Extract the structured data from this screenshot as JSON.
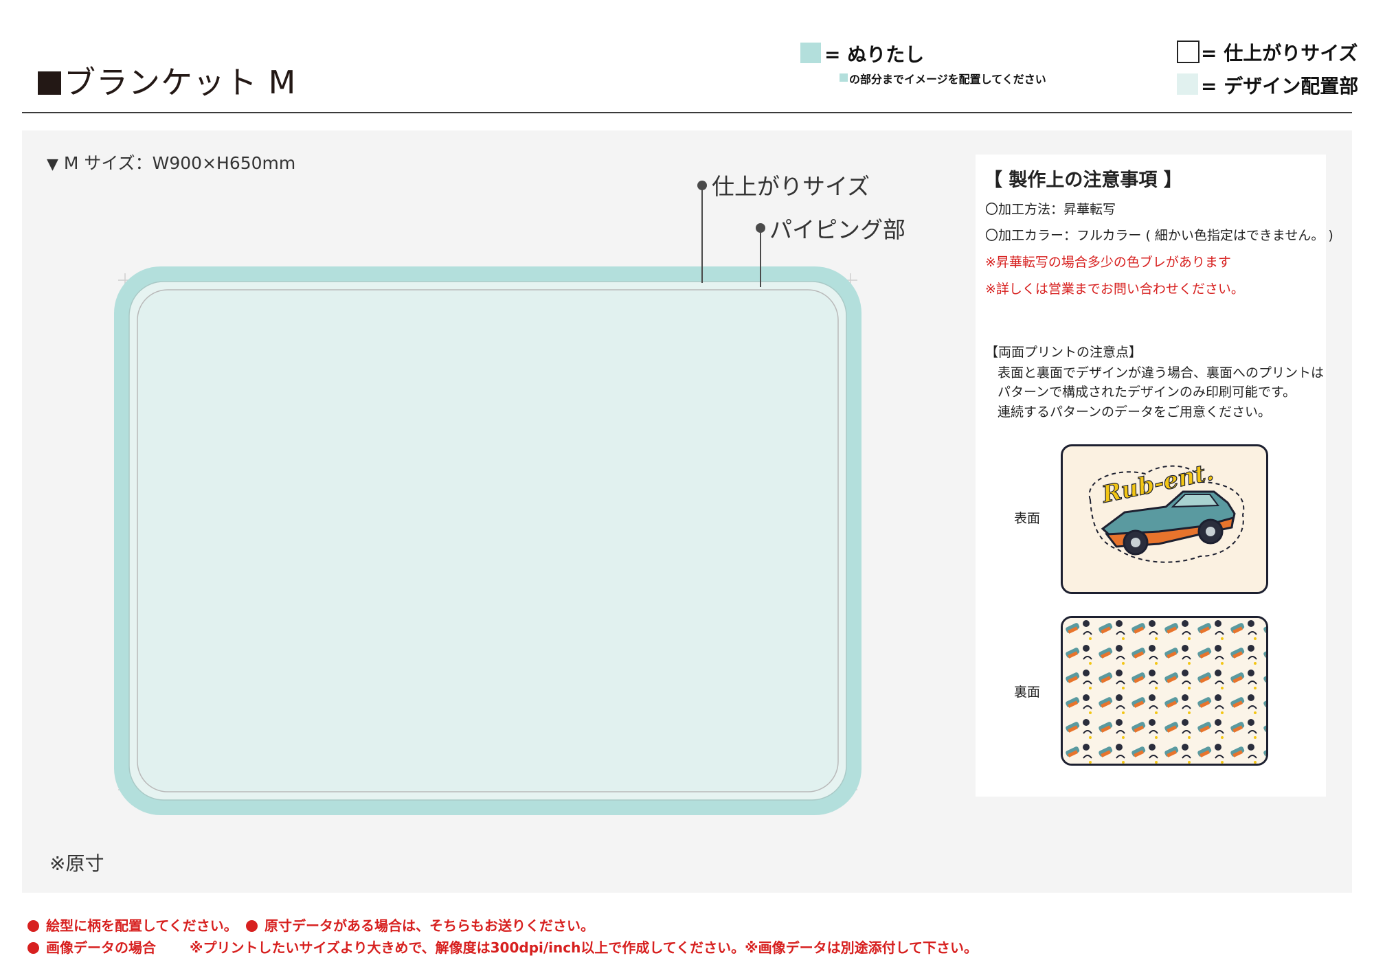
{
  "header": {
    "title": "ブランケット M",
    "legend": {
      "bleed_label": "= ぬりたし",
      "bleed_note": "の部分までイメージを配置してください",
      "finish_label": "= 仕上がりサイズ",
      "design_label": "= デザイン配置部"
    }
  },
  "colors": {
    "bleed": "#b3dfdc",
    "design_area": "#e1f1ef",
    "panel_bg": "#f4f4f4",
    "alert_red": "#d7201f"
  },
  "template": {
    "size_label": "M サイズ：W900×H650mm",
    "callout_finish": "仕上がりサイズ",
    "callout_piping": "パイピング部",
    "actual_size_note": "※原寸"
  },
  "notes": {
    "heading": "【 製作上の注意事項 】",
    "method": "〇加工方法：昇華転写",
    "color": "〇加工カラー：フルカラー ( 細かい色指定はできません。 )",
    "warn_1": "※昇華転写の場合多少の色ブレがあります",
    "warn_2": "※詳しくは営業までお問い合わせください。",
    "double_heading": "【両面プリントの注意点】",
    "double_1": "表面と裏面でデザインが違う場合、裏面へのプリントは",
    "double_2": "パターンで構成されたデザインのみ印刷可能です。",
    "double_3": "連続するパターンのデータをご用意ください。",
    "front_label": "表面",
    "back_label": "裏面",
    "logo_text": "Rub-ent."
  },
  "footer": {
    "line1_a": "絵型に柄を配置してください。",
    "line1_b": "原寸データがある場合は、そちらもお送りください。",
    "line2_a": "画像データの場合",
    "line2_b": "※プリントしたいサイズより大きめで、解像度は300dpi/inch以上で作成してください。※画像データは別途添付して下さい。"
  }
}
